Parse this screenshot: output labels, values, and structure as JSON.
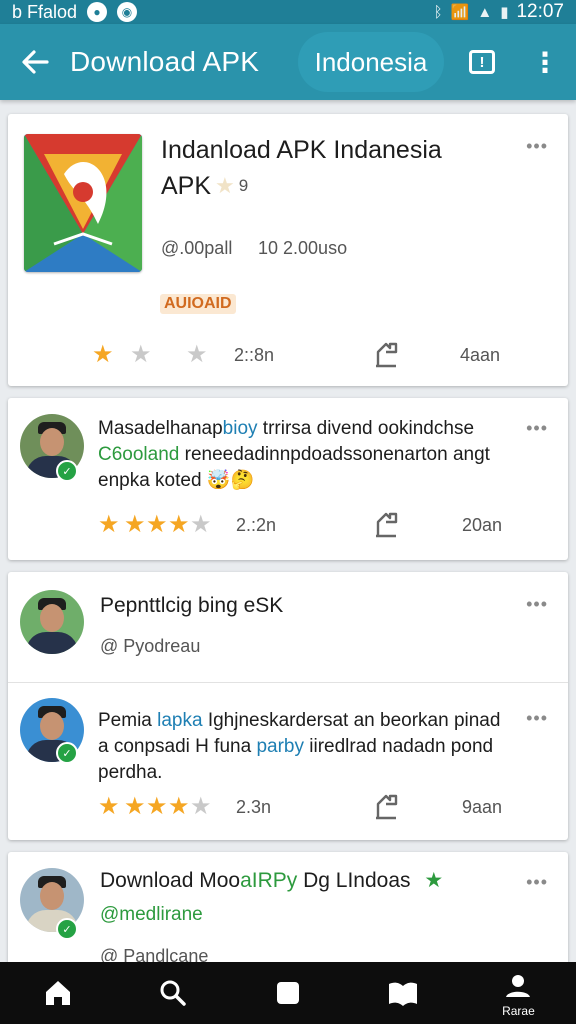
{
  "status_bar": {
    "left_text": "b Ffalod",
    "time": "12:07"
  },
  "app_bar": {
    "title": "Download APK",
    "chip": "Indonesia"
  },
  "app_card": {
    "title": "Indanload APK Indanesia",
    "subtitle": "APK",
    "subtitle_num": "9",
    "meta_left": "@.00pall",
    "meta_right": "10 2.00uso",
    "badge": "AUIOAID",
    "rating_count": "2::8n",
    "date": "4aan",
    "stars_filled": 1
  },
  "review_1": {
    "segments": [
      {
        "t": "Masadelhanap",
        "c": ""
      },
      {
        "t": "bioy",
        "c": "hl-blue"
      },
      {
        "t": " trrirsa divend ookindchse",
        "c": ""
      }
    ],
    "line2": [
      {
        "t": "C6ooland",
        "c": "hl-green"
      },
      {
        "t": " reneedadinnpdoadssonenarton angt",
        "c": ""
      }
    ],
    "line3": "enpka koted 🤯🤔",
    "rating_count": "2.:2n",
    "date": "20an",
    "stars_filled": 4
  },
  "card_3": {
    "heading": "Pepnttlcig bing eSK",
    "handle": "@ Pyodreau"
  },
  "review_2": {
    "line1": [
      {
        "t": "Pemia ",
        "c": ""
      },
      {
        "t": "lapka",
        "c": "hl-blue"
      },
      {
        "t": " Ighjneskardersat an beorkan pinad",
        "c": ""
      }
    ],
    "line2": [
      {
        "t": "a conpsadi H funa ",
        "c": ""
      },
      {
        "t": "parby",
        "c": "hl-blue"
      },
      {
        "t": " iiredlrad nadadn pond",
        "c": ""
      }
    ],
    "line3": "perdha.",
    "rating_count": "2.3n",
    "date": "9aan",
    "stars_filled": 4
  },
  "card_4": {
    "heading_main": "Download Moo",
    "heading_accent": "aIRPy",
    "heading_end": " Dg LIndoas",
    "handle": "@medlirane",
    "handle2": "@ Pandlcane"
  },
  "bottom_nav": {
    "profile_label": "Rarae"
  },
  "colors": {
    "appbar": "#2a93ab",
    "statusbar": "#1f7f97",
    "star": "#f5a623",
    "verified": "#25a244"
  }
}
